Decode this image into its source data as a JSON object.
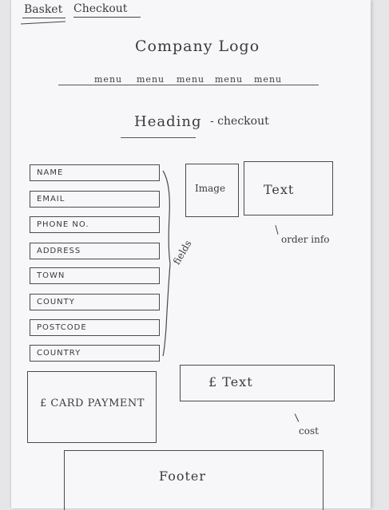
{
  "tabs": [
    {
      "label": "Basket"
    },
    {
      "label": "Checkout"
    }
  ],
  "header": {
    "logo": "Company Logo",
    "menu": [
      "menu",
      "menu",
      "menu",
      "menu",
      "menu"
    ]
  },
  "main": {
    "heading": "Heading",
    "subheading": "- checkout",
    "fields": [
      {
        "placeholder": "NAME"
      },
      {
        "placeholder": "EMAIL"
      },
      {
        "placeholder": "PHONE NO."
      },
      {
        "placeholder": "ADDRESS"
      },
      {
        "placeholder": "TOWN"
      },
      {
        "placeholder": "COUNTY"
      },
      {
        "placeholder": "POSTCODE"
      },
      {
        "placeholder": "COUNTRY"
      }
    ],
    "fields_annotation": "fields",
    "card_payment": "£ CARD PAYMENT"
  },
  "order": {
    "image_label": "Image",
    "text_label": "Text",
    "annotation": "order info"
  },
  "cost": {
    "text": "£ Text",
    "annotation": "cost"
  },
  "footer": {
    "label": "Footer"
  }
}
